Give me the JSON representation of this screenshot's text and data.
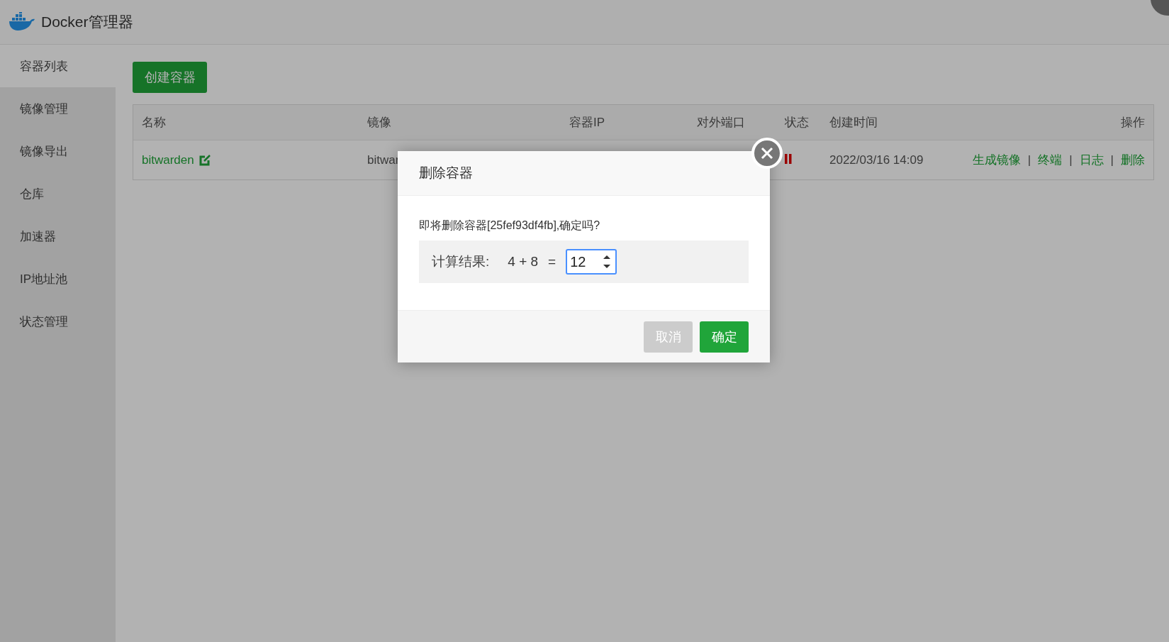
{
  "app": {
    "title": "Docker管理器"
  },
  "sidebar": {
    "items": [
      {
        "label": "容器列表",
        "selected": true
      },
      {
        "label": "镜像管理",
        "selected": false
      },
      {
        "label": "镜像导出",
        "selected": false
      },
      {
        "label": "仓库",
        "selected": false
      },
      {
        "label": "加速器",
        "selected": false
      },
      {
        "label": "IP地址池",
        "selected": false
      },
      {
        "label": "状态管理",
        "selected": false
      }
    ]
  },
  "toolbar": {
    "create_button": "创建容器"
  },
  "table": {
    "columns": [
      "名称",
      "镜像",
      "容器IP",
      "对外端口",
      "状态",
      "创建时间",
      "操作"
    ],
    "rows": [
      {
        "name": "bitwarden",
        "image": "bitwar",
        "created": "2022/03/16 14:09",
        "actions": [
          "生成镜像",
          "终端",
          "日志",
          "删除"
        ],
        "separators": [
          "|",
          "|",
          "|"
        ]
      }
    ]
  },
  "dialog": {
    "title": "删除容器",
    "message": "即将删除容器[25fef93df4fb],确定吗?",
    "captcha_label": "计算结果:",
    "expression": "4 + 8",
    "equals": "=",
    "answer": "12",
    "buttons": {
      "cancel": "取消",
      "confirm": "确定"
    }
  }
}
